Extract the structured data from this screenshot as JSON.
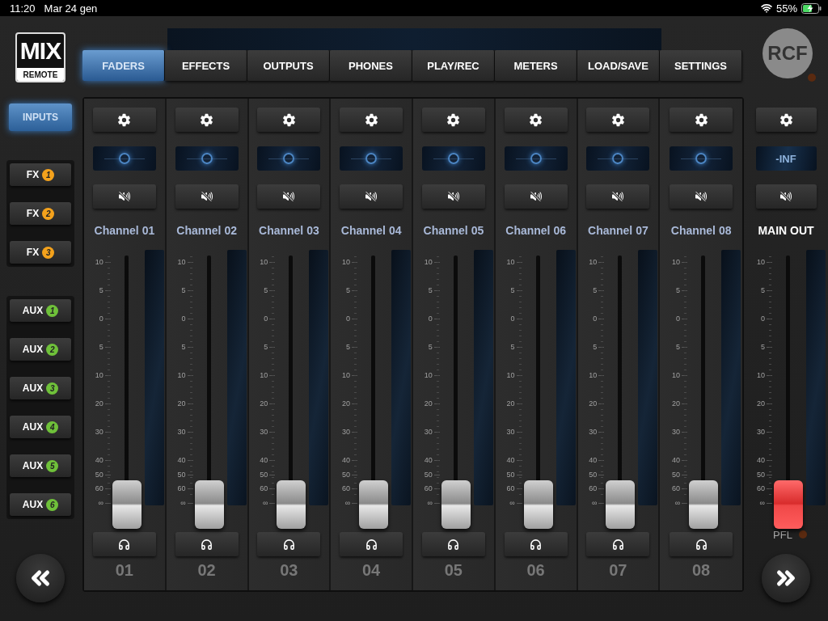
{
  "status_bar": {
    "time": "11:20",
    "date": "Mar 24 gen",
    "battery": "55%"
  },
  "logo": {
    "title": "MIX",
    "subtitle": "REMOTE"
  },
  "brand": "RCF",
  "tabs": [
    {
      "label": "FADERS",
      "selected": true
    },
    {
      "label": "EFFECTS",
      "selected": false
    },
    {
      "label": "OUTPUTS",
      "selected": false
    },
    {
      "label": "PHONES",
      "selected": false
    },
    {
      "label": "PLAY/REC",
      "selected": false
    },
    {
      "label": "METERS",
      "selected": false
    },
    {
      "label": "LOAD/SAVE",
      "selected": false
    },
    {
      "label": "SETTINGS",
      "selected": false
    }
  ],
  "sidebar": {
    "groups": [
      {
        "kind": "single",
        "items": [
          {
            "kind": "plain",
            "label": "INPUTS",
            "selected": true
          }
        ]
      },
      {
        "kind": "panel",
        "items": [
          {
            "kind": "badge",
            "label": "FX",
            "badge": "1",
            "color": "#f4a21c",
            "selected": false
          },
          {
            "kind": "badge",
            "label": "FX",
            "badge": "2",
            "color": "#f4a21c",
            "selected": false
          },
          {
            "kind": "badge",
            "label": "FX",
            "badge": "3",
            "color": "#f4a21c",
            "selected": false
          }
        ]
      },
      {
        "kind": "panel",
        "items": [
          {
            "kind": "badge",
            "label": "AUX",
            "badge": "1",
            "color": "#6fc13a",
            "selected": false
          },
          {
            "kind": "badge",
            "label": "AUX",
            "badge": "2",
            "color": "#6fc13a",
            "selected": false
          },
          {
            "kind": "badge",
            "label": "AUX",
            "badge": "3",
            "color": "#6fc13a",
            "selected": false
          },
          {
            "kind": "badge",
            "label": "AUX",
            "badge": "4",
            "color": "#6fc13a",
            "selected": false
          },
          {
            "kind": "badge",
            "label": "AUX",
            "badge": "5",
            "color": "#6fc13a",
            "selected": false
          },
          {
            "kind": "badge",
            "label": "AUX",
            "badge": "6",
            "color": "#6fc13a",
            "selected": false
          }
        ]
      }
    ]
  },
  "channels": [
    {
      "name": "Channel 01",
      "number": "01",
      "pan": {
        "level": 0.5
      },
      "fader": {
        "level": 0
      },
      "scale": [
        "10",
        "5",
        "0",
        "5",
        "10",
        "20",
        "30",
        "40",
        "50",
        "60",
        "∞"
      ]
    },
    {
      "name": "Channel 02",
      "number": "02",
      "pan": {
        "level": 0.5
      },
      "fader": {
        "level": 0
      },
      "scale": [
        "10",
        "5",
        "0",
        "5",
        "10",
        "20",
        "30",
        "40",
        "50",
        "60",
        "∞"
      ]
    },
    {
      "name": "Channel 03",
      "number": "03",
      "pan": {
        "level": 0.5
      },
      "fader": {
        "level": 0
      },
      "scale": [
        "10",
        "5",
        "0",
        "5",
        "10",
        "20",
        "30",
        "40",
        "50",
        "60",
        "∞"
      ]
    },
    {
      "name": "Channel 04",
      "number": "04",
      "pan": {
        "level": 0.5
      },
      "fader": {
        "level": 0
      },
      "scale": [
        "10",
        "5",
        "0",
        "5",
        "10",
        "20",
        "30",
        "40",
        "50",
        "60",
        "∞"
      ]
    },
    {
      "name": "Channel 05",
      "number": "05",
      "pan": {
        "level": 0.5
      },
      "fader": {
        "level": 0
      },
      "scale": [
        "10",
        "5",
        "0",
        "5",
        "10",
        "20",
        "30",
        "40",
        "50",
        "60",
        "∞"
      ]
    },
    {
      "name": "Channel 06",
      "number": "06",
      "pan": {
        "level": 0.5
      },
      "fader": {
        "level": 0
      },
      "scale": [
        "10",
        "5",
        "0",
        "5",
        "10",
        "20",
        "30",
        "40",
        "50",
        "60",
        "∞"
      ]
    },
    {
      "name": "Channel 07",
      "number": "07",
      "pan": {
        "level": 0.5
      },
      "fader": {
        "level": 0
      },
      "scale": [
        "10",
        "5",
        "0",
        "5",
        "10",
        "20",
        "30",
        "40",
        "50",
        "60",
        "∞"
      ]
    },
    {
      "name": "Channel 08",
      "number": "08",
      "pan": {
        "level": 0.5
      },
      "fader": {
        "level": 0
      },
      "scale": [
        "10",
        "5",
        "0",
        "5",
        "10",
        "20",
        "30",
        "40",
        "50",
        "60",
        "∞"
      ]
    }
  ],
  "main_out": {
    "name": "MAIN OUT",
    "reading": "-INF",
    "fader": {
      "level": 0
    },
    "scale": [
      "10",
      "5",
      "0",
      "5",
      "10",
      "20",
      "30",
      "40",
      "50",
      "60",
      "∞"
    ],
    "pfl": {
      "label": "PFL",
      "on": false
    }
  }
}
